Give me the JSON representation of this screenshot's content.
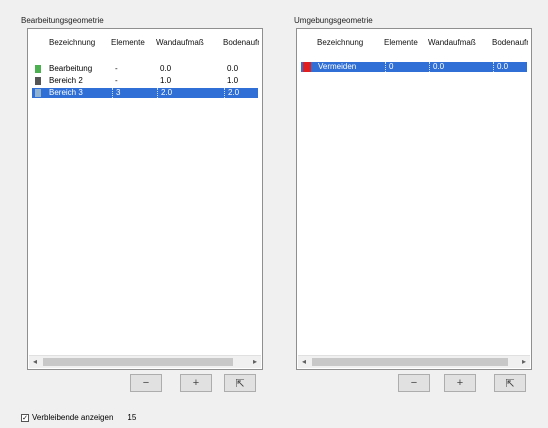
{
  "left": {
    "title": "Bearbeitungsgeometrie",
    "columns": [
      "Bezeichnung",
      "Elemente",
      "Wandaufmaß",
      "Bodenaufmaß"
    ],
    "rows": [
      {
        "name": "Bearbeitung",
        "elements": "-",
        "wall": "0.0",
        "floor": "0.0",
        "color": "#4caf50"
      },
      {
        "name": "Bereich 2",
        "elements": "-",
        "wall": "1.0",
        "floor": "1.0",
        "color": "#555555"
      },
      {
        "name": "Bereich 3",
        "elements": "3",
        "wall": "2.0",
        "floor": "2.0",
        "color": "#8fb2d0"
      }
    ],
    "scroll_left": "◂",
    "scroll_right": "▸"
  },
  "right": {
    "title": "Umgebungsgeometrie",
    "columns": [
      "Bezeichnung",
      "Elemente",
      "Wandaufmaß",
      "Bodenaufmaß"
    ],
    "rows": [
      {
        "name": "Vermeiden",
        "elements": "0",
        "wall": "0.0",
        "floor": "0.0",
        "color": "#e02020"
      }
    ],
    "scroll_left": "◂",
    "scroll_right": "▸"
  },
  "buttons": {
    "remove": "−",
    "add": "+",
    "select": "⇱"
  },
  "footer": {
    "checkbox_label": "Verbleibende anzeigen",
    "checkbox_checked": "✓",
    "value": "15"
  }
}
